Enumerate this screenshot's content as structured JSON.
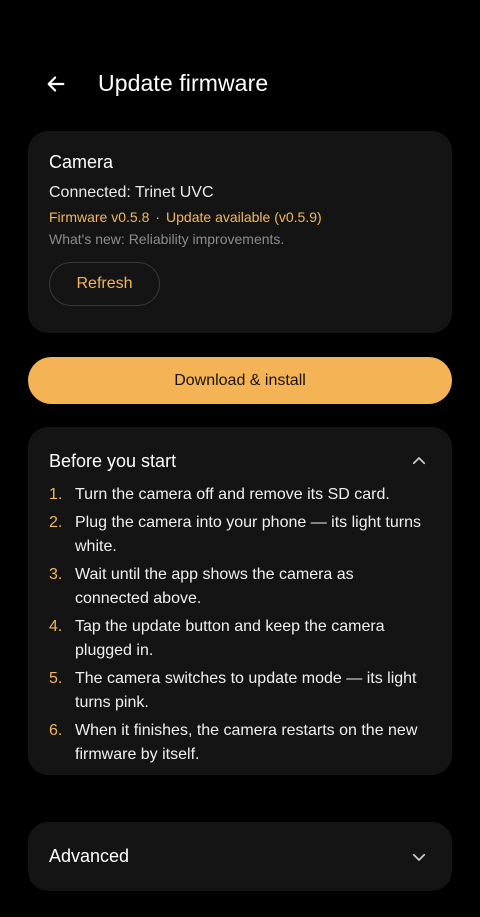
{
  "app_bar": {
    "title": "Update firmware",
    "back_icon": "arrow-left-icon"
  },
  "device": {
    "title": "Camera",
    "connected": "Connected: Trinet UVC",
    "firmware_version": "Firmware v0.5.8",
    "separator": "·",
    "update_status": "Update available (v0.5.9)",
    "whats_new": "What's new: Reliability improvements.",
    "refresh_label": "Refresh"
  },
  "primary_action": {
    "label": "Download & install"
  },
  "before_you_start": {
    "title": "Before you start",
    "expanded": true,
    "chevron_icon": "chevron-up-icon",
    "steps": [
      {
        "num": "1.",
        "text": "Turn the camera off and remove its SD card."
      },
      {
        "num": "2.",
        "text": "Plug the camera into your phone — its light turns white."
      },
      {
        "num": "3.",
        "text": "Wait until the app shows the camera as connected above."
      },
      {
        "num": "4.",
        "text": "Tap the update button and keep the camera plugged in."
      },
      {
        "num": "5.",
        "text": "The camera switches to update mode — its light turns pink."
      },
      {
        "num": "6.",
        "text": "When it finishes, the camera restarts on the new firmware by itself."
      }
    ]
  },
  "advanced": {
    "title": "Advanced",
    "expanded": false,
    "chevron_icon": "chevron-down-icon"
  },
  "colors": {
    "background": "#000000",
    "card": "#141414",
    "accent": "#f4b455",
    "accent_text": "#f3b75a",
    "muted_text": "#8c8c8c"
  }
}
